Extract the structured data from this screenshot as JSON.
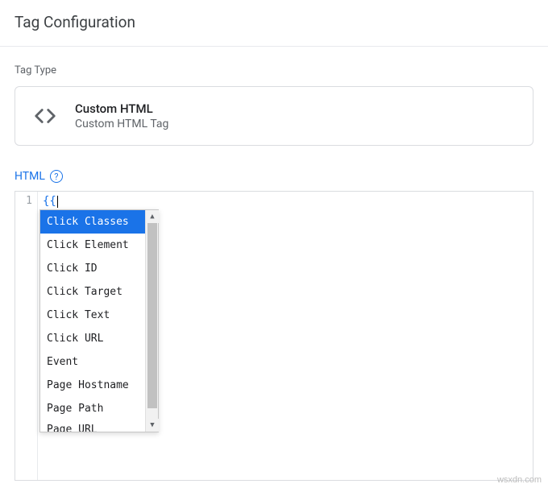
{
  "header": {
    "title": "Tag Configuration"
  },
  "tag_type": {
    "label": "Tag Type",
    "title": "Custom HTML",
    "subtitle": "Custom HTML Tag"
  },
  "editor": {
    "label": "HTML",
    "help_symbol": "?",
    "line_number": "1",
    "code": "{{",
    "autocomplete": {
      "selected_index": 0,
      "items": [
        "Click Classes",
        "Click Element",
        "Click ID",
        "Click Target",
        "Click Text",
        "Click URL",
        "Event",
        "Page Hostname",
        "Page Path",
        "Page URL"
      ]
    }
  },
  "watermark": "wsxdn.com"
}
